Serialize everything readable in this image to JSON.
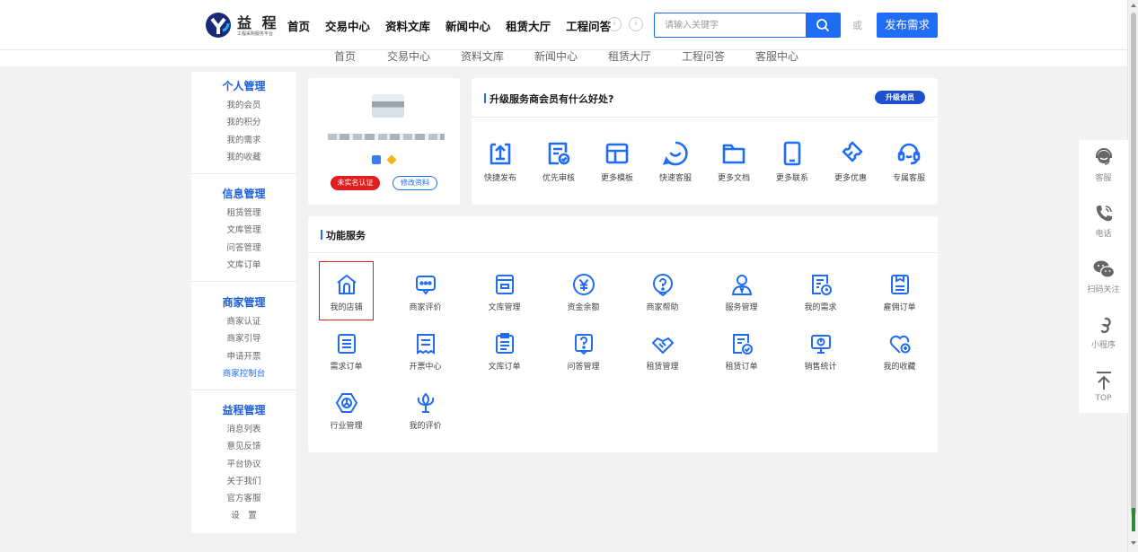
{
  "header": {
    "logo_title": "益 程",
    "logo_subtitle": "工程采购服务平台",
    "nav": [
      "首页",
      "交易中心",
      "资料文库",
      "新闻中心",
      "租赁大厅",
      "工程问答"
    ],
    "search_placeholder": "请输入关键字",
    "or_text": "或",
    "publish_button": "发布需求"
  },
  "subnav": [
    "首页",
    "交易中心",
    "资料文库",
    "新闻中心",
    "租赁大厅",
    "工程问答",
    "客服中心"
  ],
  "sidebar": {
    "personal": {
      "title": "个人管理",
      "items": [
        "我的会员",
        "我的积分",
        "我的需求",
        "我的收藏"
      ]
    },
    "info": {
      "title": "信息管理",
      "items": [
        "租赁管理",
        "文库管理",
        "问答管理",
        "文库订单"
      ]
    },
    "merchant": {
      "title": "商家管理",
      "items": [
        "商家认证",
        "商家引导",
        "申请开票",
        "商家控制台"
      ],
      "active": "商家控制台"
    },
    "yicheng": {
      "title": "益程管理",
      "items": [
        "消息列表",
        "意见反馈",
        "平台协议",
        "关于我们",
        "官方客服",
        "设　置"
      ]
    }
  },
  "profile": {
    "unverified_label": "未实名认证",
    "edit_label": "修改资料"
  },
  "upgrade": {
    "title": "升级服务商会员有什么好处?",
    "button": "升级会员",
    "benefits": [
      {
        "label": "快捷发布",
        "icon": "quick-publish-icon"
      },
      {
        "label": "优先审核",
        "icon": "priority-review-icon"
      },
      {
        "label": "更多模板",
        "icon": "template-icon"
      },
      {
        "label": "快速客服",
        "icon": "quick-service-icon"
      },
      {
        "label": "更多文档",
        "icon": "folder-icon"
      },
      {
        "label": "更多联系",
        "icon": "phone-icon"
      },
      {
        "label": "更多优惠",
        "icon": "ticket-icon"
      },
      {
        "label": "专属客服",
        "icon": "headset-icon"
      }
    ]
  },
  "functions": {
    "title": "功能服务",
    "selected": "我的店铺",
    "items": [
      {
        "label": "我的店铺",
        "icon": "shop-icon"
      },
      {
        "label": "商家评价",
        "icon": "comment-icon"
      },
      {
        "label": "文库管理",
        "icon": "library-icon"
      },
      {
        "label": "资金余额",
        "icon": "yuan-icon"
      },
      {
        "label": "商家帮助",
        "icon": "help-icon"
      },
      {
        "label": "服务管理",
        "icon": "service-user-icon"
      },
      {
        "label": "我的需求",
        "icon": "demand-icon"
      },
      {
        "label": "雇佣订单",
        "icon": "hire-order-icon"
      },
      {
        "label": "需求订单",
        "icon": "demand-order-icon"
      },
      {
        "label": "开票中心",
        "icon": "invoice-icon"
      },
      {
        "label": "文库订单",
        "icon": "library-order-icon"
      },
      {
        "label": "问答管理",
        "icon": "qa-icon"
      },
      {
        "label": "租赁管理",
        "icon": "handshake-icon"
      },
      {
        "label": "租赁订单",
        "icon": "lease-order-icon"
      },
      {
        "label": "销售统计",
        "icon": "sales-stats-icon"
      },
      {
        "label": "我的收藏",
        "icon": "favorite-icon"
      },
      {
        "label": "行业管理",
        "icon": "industry-icon"
      },
      {
        "label": "我的评价",
        "icon": "my-review-icon"
      }
    ]
  },
  "float_bar": [
    {
      "label": "客服",
      "icon": "customer-service-icon"
    },
    {
      "label": "电话",
      "icon": "phone-call-icon"
    },
    {
      "label": "扫码关注",
      "icon": "wechat-icon"
    },
    {
      "label": "小程序",
      "icon": "mini-program-icon"
    },
    {
      "label": "TOP",
      "icon": "arrow-top-icon"
    }
  ],
  "colors": {
    "primary": "#1f6cf5",
    "danger": "#e02020",
    "sidebar_heading": "#1f5fd6",
    "background": "#f2f2f2"
  }
}
